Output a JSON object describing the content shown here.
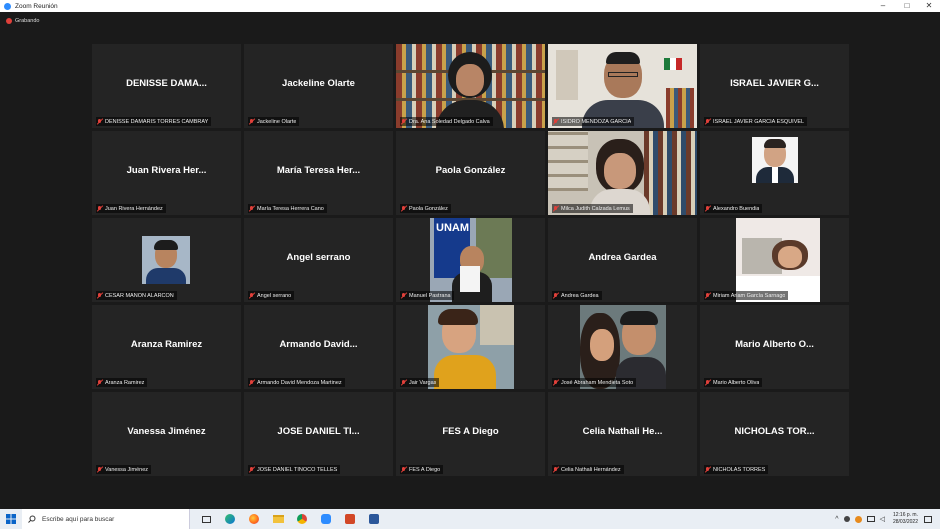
{
  "window": {
    "title": "Zoom Reunión"
  },
  "recording": {
    "label": "Grabando"
  },
  "participants": [
    {
      "display": "DENISSE DAMA...",
      "tag": "DENISSE DAMARIS TORRES CAMBRAY"
    },
    {
      "display": "Jackeline Olarte",
      "tag": "Jackeline Olarte"
    },
    {
      "display": "",
      "tag": "Dra. Ana Soledad Delgado Calva",
      "video": "bookshelf-woman"
    },
    {
      "display": "",
      "tag": "ISIDRO MENDOZA GARCIA",
      "video": "man-office",
      "active": true
    },
    {
      "display": "ISRAEL JAVIER G...",
      "tag": "ISRAEL JAVIER GARCIA ESQUIVEL"
    },
    {
      "display": "Juan Rivera Her...",
      "tag": "Juan Rivera Hernández"
    },
    {
      "display": "María Teresa Her...",
      "tag": "María Teresa Herrera Cano"
    },
    {
      "display": "Paola González",
      "tag": "Paola González"
    },
    {
      "display": "",
      "tag": "Milca Judith Calzada Lemus",
      "video": "girl-shelf"
    },
    {
      "display": "",
      "tag": "Alexandro Buendia",
      "video": "man-suit-photo"
    },
    {
      "display": "",
      "tag": "CESAR MAÑON ALARCON",
      "video": "young-man-photo"
    },
    {
      "display": "Angel serrano",
      "tag": "Angel serrano"
    },
    {
      "display": "",
      "tag": "Manuel Pastrana",
      "video": "unam-banner"
    },
    {
      "display": "Andrea Gardea",
      "tag": "Andrea Gardea"
    },
    {
      "display": "",
      "tag": "Miriam Ariam García Sarnago",
      "video": "woman-photo"
    },
    {
      "display": "Aranza Ramirez",
      "tag": "Aranza Ramirez"
    },
    {
      "display": "Armando David...",
      "tag": "Armando David Mendoza Martinez"
    },
    {
      "display": "",
      "tag": "Jair Vargas",
      "video": "boy-yellow"
    },
    {
      "display": "",
      "tag": "José Abraham Mendieta Soto",
      "video": "couple-selfie"
    },
    {
      "display": "Mario Alberto O...",
      "tag": "Mario Alberto Oliva"
    },
    {
      "display": "Vanessa Jiménez",
      "tag": "Vanessa Jiménez"
    },
    {
      "display": "JOSE DANIEL TI...",
      "tag": "JOSE DANIEL TINOCO TELLES"
    },
    {
      "display": "FES A Diego",
      "tag": "FES A Diego"
    },
    {
      "display": "Celia Nathali He...",
      "tag": "Celia Nathali Hernández"
    },
    {
      "display": "NICHOLAS TOR...",
      "tag": "NICHOLAS TORRES"
    }
  ],
  "banner_text": "UNAM",
  "taskbar": {
    "search_placeholder": "Escribe aquí para buscar",
    "time": "12:16 p. m.",
    "date": "28/03/2022",
    "apps": [
      "task-view-icon",
      "edge-icon",
      "firefox-icon",
      "file-explorer-icon",
      "chrome-icon",
      "zoom-icon",
      "powerpoint-icon",
      "word-icon"
    ]
  }
}
